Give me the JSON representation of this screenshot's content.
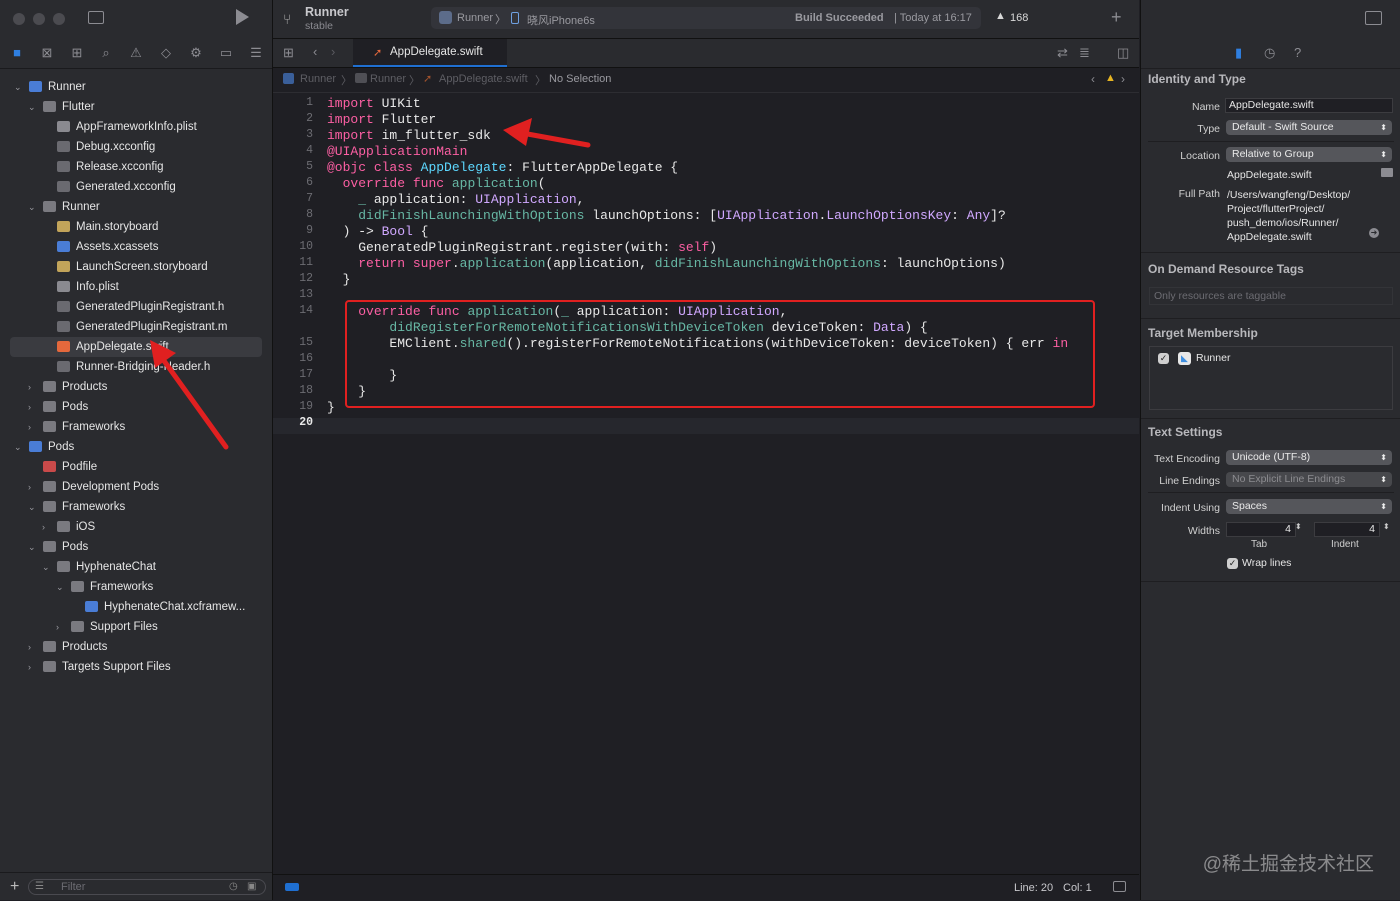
{
  "toolbar": {
    "scheme": "Runner",
    "branch": "stable",
    "target_app": "Runner",
    "device": "晓风iPhone6s",
    "build_status_bold": "Build Succeeded",
    "build_status_time": "| Today at 16:17",
    "warnings_count": "168"
  },
  "navigator": {
    "items": [
      {
        "label": "Runner",
        "depth": 0,
        "chev": "down",
        "icon": "project-icon",
        "color": "#4a7dd6"
      },
      {
        "label": "Flutter",
        "depth": 1,
        "chev": "down",
        "icon": "folder-icon",
        "color": "#7a7a80"
      },
      {
        "label": "AppFrameworkInfo.plist",
        "depth": 2,
        "chev": "",
        "icon": "plist-icon",
        "color": "#8a8a90"
      },
      {
        "label": "Debug.xcconfig",
        "depth": 2,
        "chev": "",
        "icon": "xcconfig-icon",
        "color": "#6a6a70"
      },
      {
        "label": "Release.xcconfig",
        "depth": 2,
        "chev": "",
        "icon": "xcconfig-icon",
        "color": "#6a6a70"
      },
      {
        "label": "Generated.xcconfig",
        "depth": 2,
        "chev": "",
        "icon": "xcconfig-icon",
        "color": "#6a6a70"
      },
      {
        "label": "Runner",
        "depth": 1,
        "chev": "down",
        "icon": "folder-icon",
        "color": "#7a7a80"
      },
      {
        "label": "Main.storyboard",
        "depth": 2,
        "chev": "",
        "icon": "storyboard-icon",
        "color": "#c2a45a"
      },
      {
        "label": "Assets.xcassets",
        "depth": 2,
        "chev": "",
        "icon": "assets-icon",
        "color": "#4a7dd6"
      },
      {
        "label": "LaunchScreen.storyboard",
        "depth": 2,
        "chev": "",
        "icon": "storyboard-icon",
        "color": "#c2a45a"
      },
      {
        "label": "Info.plist",
        "depth": 2,
        "chev": "",
        "icon": "plist-icon",
        "color": "#8a8a90"
      },
      {
        "label": "GeneratedPluginRegistrant.h",
        "depth": 2,
        "chev": "",
        "icon": "header-file-icon",
        "color": "#6a6a70"
      },
      {
        "label": "GeneratedPluginRegistrant.m",
        "depth": 2,
        "chev": "",
        "icon": "objc-file-icon",
        "color": "#6a6a70"
      },
      {
        "label": "AppDelegate.swift",
        "depth": 2,
        "chev": "",
        "icon": "swift-file-icon",
        "color": "#e4683c",
        "selected": true
      },
      {
        "label": "Runner-Bridging-Header.h",
        "depth": 2,
        "chev": "",
        "icon": "header-file-icon",
        "color": "#6a6a70"
      },
      {
        "label": "Products",
        "depth": 1,
        "chev": "right",
        "icon": "folder-icon",
        "color": "#7a7a80"
      },
      {
        "label": "Pods",
        "depth": 1,
        "chev": "right",
        "icon": "folder-icon",
        "color": "#7a7a80"
      },
      {
        "label": "Frameworks",
        "depth": 1,
        "chev": "right",
        "icon": "folder-icon",
        "color": "#7a7a80"
      },
      {
        "label": "Pods",
        "depth": 0,
        "chev": "down",
        "icon": "project-icon",
        "color": "#4a7dd6"
      },
      {
        "label": "Podfile",
        "depth": 1,
        "chev": "",
        "icon": "podfile-icon",
        "color": "#c94a4a"
      },
      {
        "label": "Development Pods",
        "depth": 1,
        "chev": "right",
        "icon": "folder-icon",
        "color": "#7a7a80"
      },
      {
        "label": "Frameworks",
        "depth": 1,
        "chev": "down",
        "icon": "folder-icon",
        "color": "#7a7a80"
      },
      {
        "label": "iOS",
        "depth": 2,
        "chev": "right",
        "icon": "folder-icon",
        "color": "#7a7a80"
      },
      {
        "label": "Pods",
        "depth": 1,
        "chev": "down",
        "icon": "folder-icon",
        "color": "#7a7a80"
      },
      {
        "label": "HyphenateChat",
        "depth": 2,
        "chev": "down",
        "icon": "folder-icon",
        "color": "#7a7a80"
      },
      {
        "label": "Frameworks",
        "depth": 3,
        "chev": "down",
        "icon": "folder-icon",
        "color": "#7a7a80"
      },
      {
        "label": "HyphenateChat.xcframew...",
        "depth": 4,
        "chev": "",
        "icon": "xcframework-icon",
        "color": "#4a7dd6"
      },
      {
        "label": "Support Files",
        "depth": 3,
        "chev": "right",
        "icon": "folder-icon",
        "color": "#7a7a80"
      },
      {
        "label": "Products",
        "depth": 1,
        "chev": "right",
        "icon": "folder-icon",
        "color": "#7a7a80"
      },
      {
        "label": "Targets Support Files",
        "depth": 1,
        "chev": "right",
        "icon": "folder-icon",
        "color": "#7a7a80"
      }
    ],
    "filter_placeholder": "Filter"
  },
  "editor": {
    "tab_label": "AppDelegate.swift",
    "jumpbar": [
      "Runner",
      "Runner",
      "AppDelegate.swift",
      "No Selection"
    ],
    "line_numbers": [
      "1",
      "2",
      "3",
      "4",
      "5",
      "6",
      "7",
      "8",
      "9",
      "10",
      "11",
      "12",
      "13",
      "14",
      "",
      "15",
      "16",
      "17",
      "18",
      "19",
      "20"
    ],
    "status_line": "Line: 20",
    "status_col": "Col: 1"
  },
  "inspector": {
    "identity_title": "Identity and Type",
    "name_label": "Name",
    "name_value": "AppDelegate.swift",
    "type_label": "Type",
    "type_value": "Default - Swift Source",
    "location_label": "Location",
    "location_value": "Relative to Group",
    "location_file": "AppDelegate.swift",
    "fullpath_label": "Full Path",
    "fullpath_lines": [
      "/Users/wangfeng/Desktop/",
      "Project/flutterProject/",
      "push_demo/ios/Runner/",
      "AppDelegate.swift"
    ],
    "odr_title": "On Demand Resource Tags",
    "odr_placeholder": "Only resources are taggable",
    "membership_title": "Target Membership",
    "membership_target": "Runner",
    "text_settings_title": "Text Settings",
    "encoding_label": "Text Encoding",
    "encoding_value": "Unicode (UTF-8)",
    "line_endings_label": "Line Endings",
    "line_endings_value": "No Explicit Line Endings",
    "indent_label": "Indent Using",
    "indent_value": "Spaces",
    "widths_label": "Widths",
    "tab_width": "4",
    "indent_width": "4",
    "tab_caption": "Tab",
    "indent_caption": "Indent",
    "wrap_label": "Wrap lines"
  },
  "watermark": "@稀土掘金技术社区",
  "colors": {
    "annotation_red": "#e02020",
    "selection": "#3a3b40",
    "accent": "#1f6fd1"
  }
}
